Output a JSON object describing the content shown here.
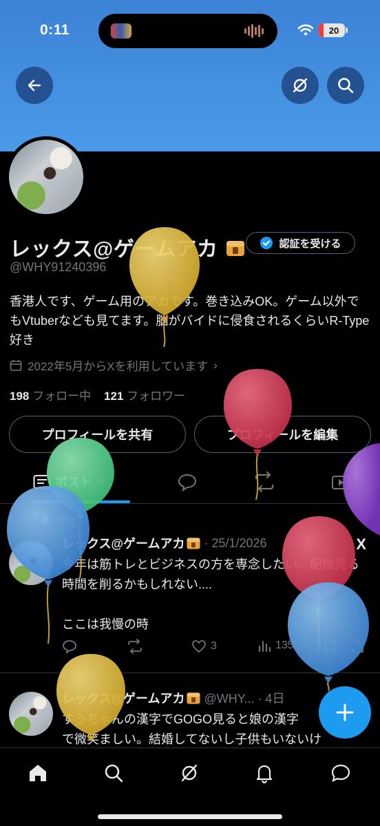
{
  "status_bar": {
    "time": "0:11",
    "battery": "20"
  },
  "profile": {
    "name": "レックス@ゲームアカ",
    "verify_label": "認証を受ける",
    "handle": "@WHY91240396",
    "bio": "香港人です、ゲーム用のアカです。巻き込みOK。ゲーム以外でもVtuberなども見てます。脳がバイドに侵食されるくらいR-Type好き",
    "joined": "2022年5月からXを利用しています",
    "following_count": "198",
    "following_label": "フォロー中",
    "followers_count": "121",
    "followers_label": "フォロワー",
    "share_label": "プロフィールを共有",
    "edit_label": "プロフィールを編集"
  },
  "tabs": {
    "posts_label": "ポスト"
  },
  "pinned_label": "固定",
  "posts": [
    {
      "name": "レックス@ゲームアカ",
      "meta": "· 25/1/2026",
      "text": "今年は筋トレとビジネスの方を専念したい、配信見る時間を削るかもしれない....\n\nここは我慢の時",
      "likes": "3",
      "views": "135"
    },
    {
      "name": "レックス@ゲームアカ",
      "meta": "@WHY... · 4日",
      "text": "すうちゃんの漢字でGOGO見ると娘の漢字\nで微笑ましい。結婚してないし子供もいないけ"
    }
  ],
  "colors": {
    "accent": "#1d9bf0",
    "banner": "#4a9ae8",
    "muted": "#71767b",
    "border": "#2f3336"
  },
  "icons": [
    "back-arrow-icon",
    "grok-icon",
    "search-icon",
    "verified-badge-icon",
    "calendar-icon",
    "pin-icon",
    "reply-icon",
    "repost-icon",
    "like-icon",
    "views-icon",
    "bookmark-icon",
    "share-icon",
    "compose-plus-icon",
    "home-icon",
    "notifications-icon",
    "messages-icon",
    "balloon-decoration"
  ]
}
